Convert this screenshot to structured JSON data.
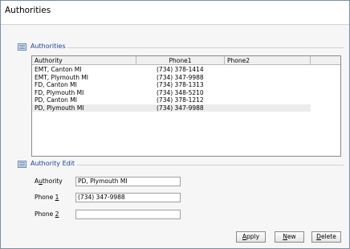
{
  "window": {
    "title": "Authorities"
  },
  "list_group": {
    "label": "Authorities"
  },
  "grid": {
    "columns": [
      "Authority",
      "Phone1",
      "Phone2"
    ],
    "rows": [
      {
        "authority": "EMT, Canton MI",
        "phone1": "(734) 378-1414",
        "phone2": ""
      },
      {
        "authority": "EMT, Plymouth MI",
        "phone1": "(734) 347-9988",
        "phone2": ""
      },
      {
        "authority": "FD, Canton MI",
        "phone1": "(734) 378-1313",
        "phone2": ""
      },
      {
        "authority": "FD, Plymouth MI",
        "phone1": "(734) 348-5210",
        "phone2": ""
      },
      {
        "authority": "PD, Canton MI",
        "phone1": "(734) 378-1212",
        "phone2": ""
      },
      {
        "authority": "PD, Plymouth MI",
        "phone1": "(734) 347-9988",
        "phone2": ""
      }
    ],
    "selected_row": 5
  },
  "edit_group": {
    "label": "Authority Edit",
    "authority_label_pre": "A",
    "authority_label_key": "u",
    "authority_label_post": "thority",
    "authority_value": "PD, Plymouth MI",
    "phone1_label_pre": "Phone ",
    "phone1_label_key": "1",
    "phone1_value": "(734) 347-9988",
    "phone2_label_pre": "Phone ",
    "phone2_label_key": "2",
    "phone2_value": ""
  },
  "buttons": {
    "apply_key": "A",
    "apply_rest": "pply",
    "new_key": "N",
    "new_rest": "ew",
    "delete_key": "D",
    "delete_rest": "elete"
  },
  "colors": {
    "group_label": "#1a3fa8",
    "window_border": "#7a8ea8",
    "selected_row": "#ececec"
  },
  "icons": {
    "group_icon": "list-panel-icon"
  }
}
